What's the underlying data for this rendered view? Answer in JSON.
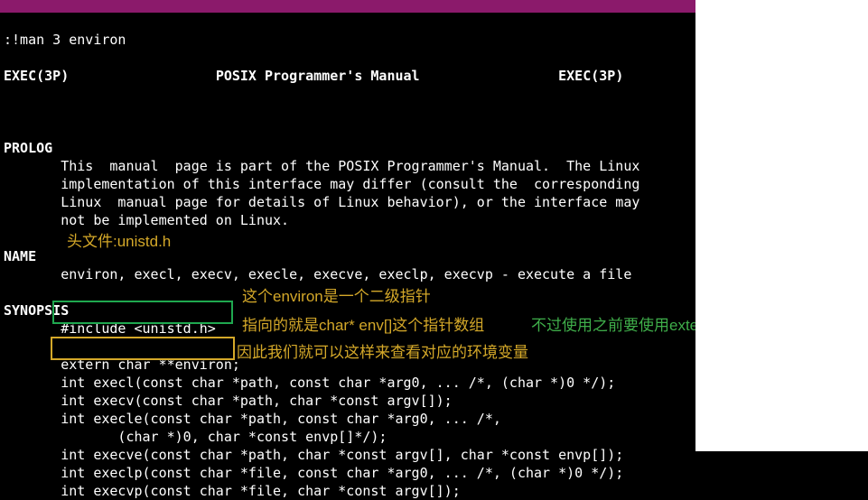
{
  "titlebar": {
    "text": ""
  },
  "cmd": ":!man 3 environ",
  "header": {
    "left": "EXEC(3P)",
    "center": "POSIX Programmer's Manual",
    "right": "EXEC(3P)"
  },
  "prolog": {
    "heading": "PROLOG",
    "l1": "       This  manual  page is part of the POSIX Programmer's Manual.  The Linux",
    "l2": "       implementation of this interface may differ (consult the  corresponding",
    "l3": "       Linux  manual page for details of Linux behavior), or the interface may",
    "l4": "       not be implemented on Linux."
  },
  "name": {
    "heading": "NAME",
    "l1": "       environ, execl, execv, execle, execve, execlp, execvp - execute a file"
  },
  "synopsis": {
    "heading": "SYNOPSIS",
    "include": "       #include <unistd.h>",
    "extern": "       extern char **environ;",
    "fn1": "       int execl(const char *path, const char *arg0, ... /*, (char *)0 */);",
    "fn2": "       int execv(const char *path, char *const argv[]);",
    "fn3": "       int execle(const char *path, const char *arg0, ... /*,",
    "fn4": "              (char *)0, char *const envp[]*/);",
    "fn5": "       int execve(const char *path, char *const argv[], char *const envp[]);",
    "fn6": "       int execlp(const char *file, const char *arg0, ... /*, (char *)0 */);",
    "fn7": "       int execvp(const char *file, char *const argv[]);"
  },
  "annotations": {
    "header_file": "头文件:unistd.h",
    "ptr_level": "这个environ是一个二级指针",
    "points_to": "指向的就是char* env[]这个指针数组",
    "extern_note": "不过使用之前要使用extern 来声明这个变量",
    "therefore": "因此我们就可以这样来查看对应的环境变量"
  }
}
